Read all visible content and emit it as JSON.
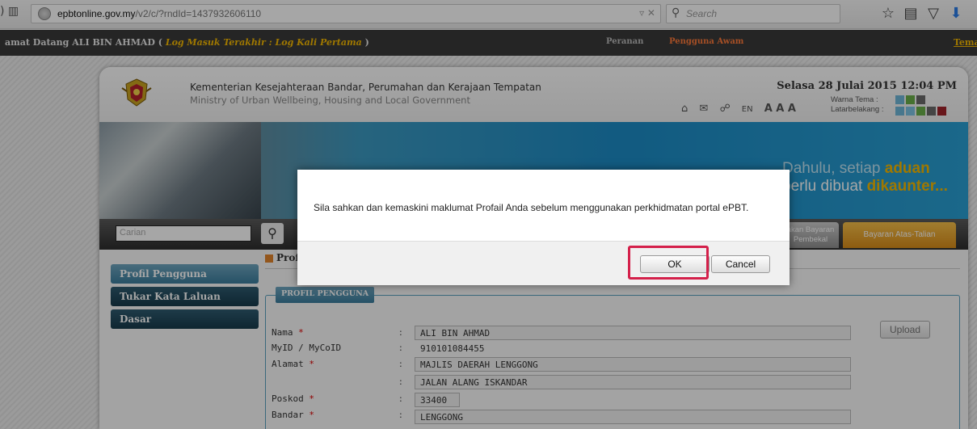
{
  "browser": {
    "url_domain": "epbtonline.gov.my",
    "url_path": "/v2/c/?rndId=1437932606110",
    "search_placeholder": "Search"
  },
  "topbar": {
    "welcome_prefix": "amat Datang ALI BIN AHMAD (",
    "last_login": "Log Masuk Terakhir : Log Kali Pertama",
    "welcome_suffix": ")",
    "role_label": "Peranan",
    "role_value": "Pengguna Awam",
    "theme_link": "Tema"
  },
  "header": {
    "ministry_ms": "Kementerian Kesejahteraan Bandar, Perumahan dan Kerajaan Tempatan",
    "ministry_en": "Ministry of Urban Wellbeing, Housing and Local Government",
    "date": "Selasa 28 Julai 2015 12:04 PM",
    "lang": "EN",
    "font_sizes": "A A A",
    "theme_label": "Warna Tema :",
    "bg_label": "Latarbelakang :",
    "theme_colors": [
      "#6fb7d9",
      "#6bb04a",
      "#6a6a6a"
    ],
    "bg_colors": [
      "#6fb7d9",
      "#7ec4e3",
      "#6bb04a",
      "#6a6a6a",
      "#a0232a"
    ]
  },
  "banner": {
    "lead": "Dahulu, setiap ",
    "accent": "aduan",
    "middle": " perlu dibuat ",
    "bold": "dikaunter..."
  },
  "menu": {
    "search_placeholder": "Carian",
    "tab_bayaran": "akan Bayaran Pembekal",
    "tab_atas_talian": "Bayaran Atas-Talian"
  },
  "sidebar": {
    "items": [
      {
        "label": "Profil Pengguna"
      },
      {
        "label": "Tukar Kata Laluan"
      },
      {
        "label": "Dasar"
      }
    ]
  },
  "content": {
    "crumb": "Profi",
    "legend": "PROFIL PENGGUNA",
    "upload": "Upload",
    "fields": [
      {
        "label": "Nama",
        "value": "ALI BIN AHMAD"
      },
      {
        "label": "MyID / MyCoID",
        "value": "910101084455"
      },
      {
        "label": "Alamat",
        "value": "MAJLIS DAERAH LENGGONG"
      },
      {
        "label": "",
        "value": "JALAN ALANG ISKANDAR"
      },
      {
        "label": "Poskod",
        "value": "33400"
      },
      {
        "label": "Bandar",
        "value": "LENGGONG"
      }
    ]
  },
  "modal": {
    "message": "Sila sahkan dan kemaskini maklumat Profail Anda sebelum menggunakan perkhidmatan portal ePBT.",
    "ok": "OK",
    "cancel": "Cancel"
  }
}
